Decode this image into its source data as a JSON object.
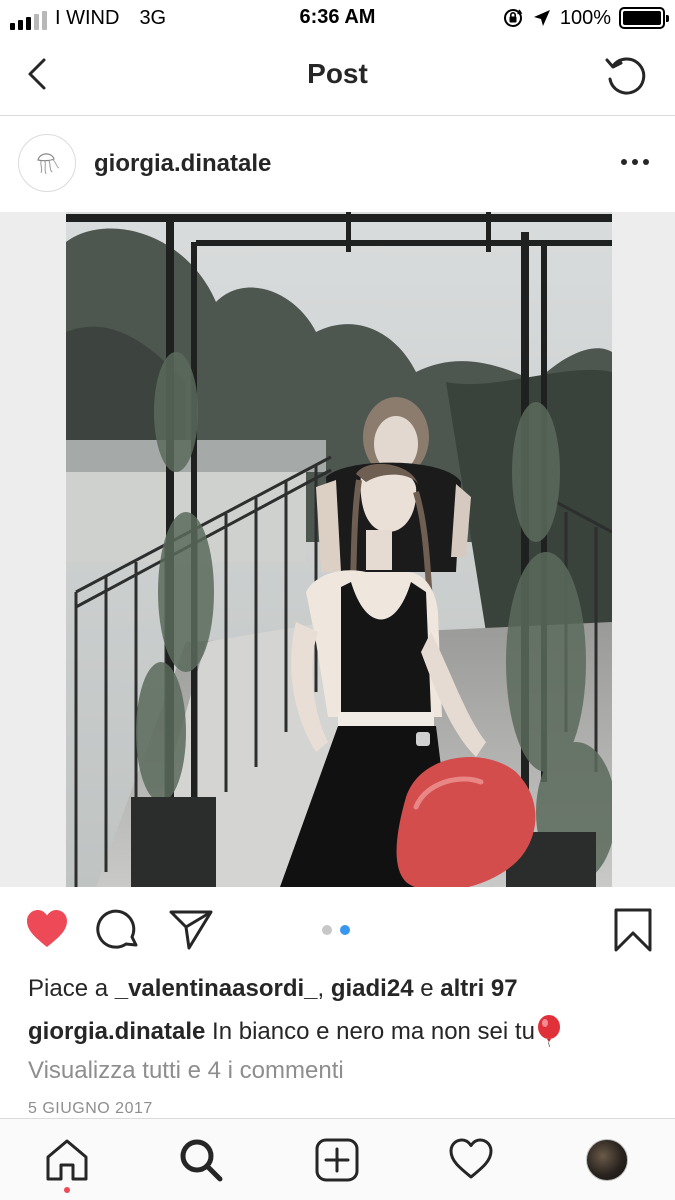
{
  "status_bar": {
    "carrier": "I WIND",
    "network": "3G",
    "time": "6:36 AM",
    "battery": "100%",
    "signal_bars_active": 3,
    "signal_bars_total": 5
  },
  "nav": {
    "title": "Post",
    "back_icon": "chevron-left-icon",
    "refresh_icon": "refresh-icon"
  },
  "post": {
    "username": "giorgia.dinatale",
    "more_icon": "more-options-icon",
    "carousel": {
      "total": 2,
      "current": 2
    },
    "liked": true,
    "likes": {
      "prefix": "Piace a",
      "user1": "_valentinaasordi_",
      "separator": ",",
      "user2": "giadi24",
      "joiner": "e",
      "others": "altri 97"
    },
    "caption": {
      "username": "giorgia.dinatale",
      "text": "In bianco e nero ma non sei tu",
      "emoji": "balloon"
    },
    "view_comments": "Visualizza tutti e 4 i commenti",
    "date": "5 GIUGNO 2017"
  },
  "colors": {
    "heart": "#ed4956",
    "dot_active": "#3897f0",
    "dot_inactive": "#c7c7c7",
    "text": "#262626",
    "muted": "#8e8e8e"
  },
  "tab_bar": {
    "items": [
      "home-icon",
      "search-icon",
      "add-post-icon",
      "activity-heart-icon",
      "profile-avatar"
    ]
  }
}
